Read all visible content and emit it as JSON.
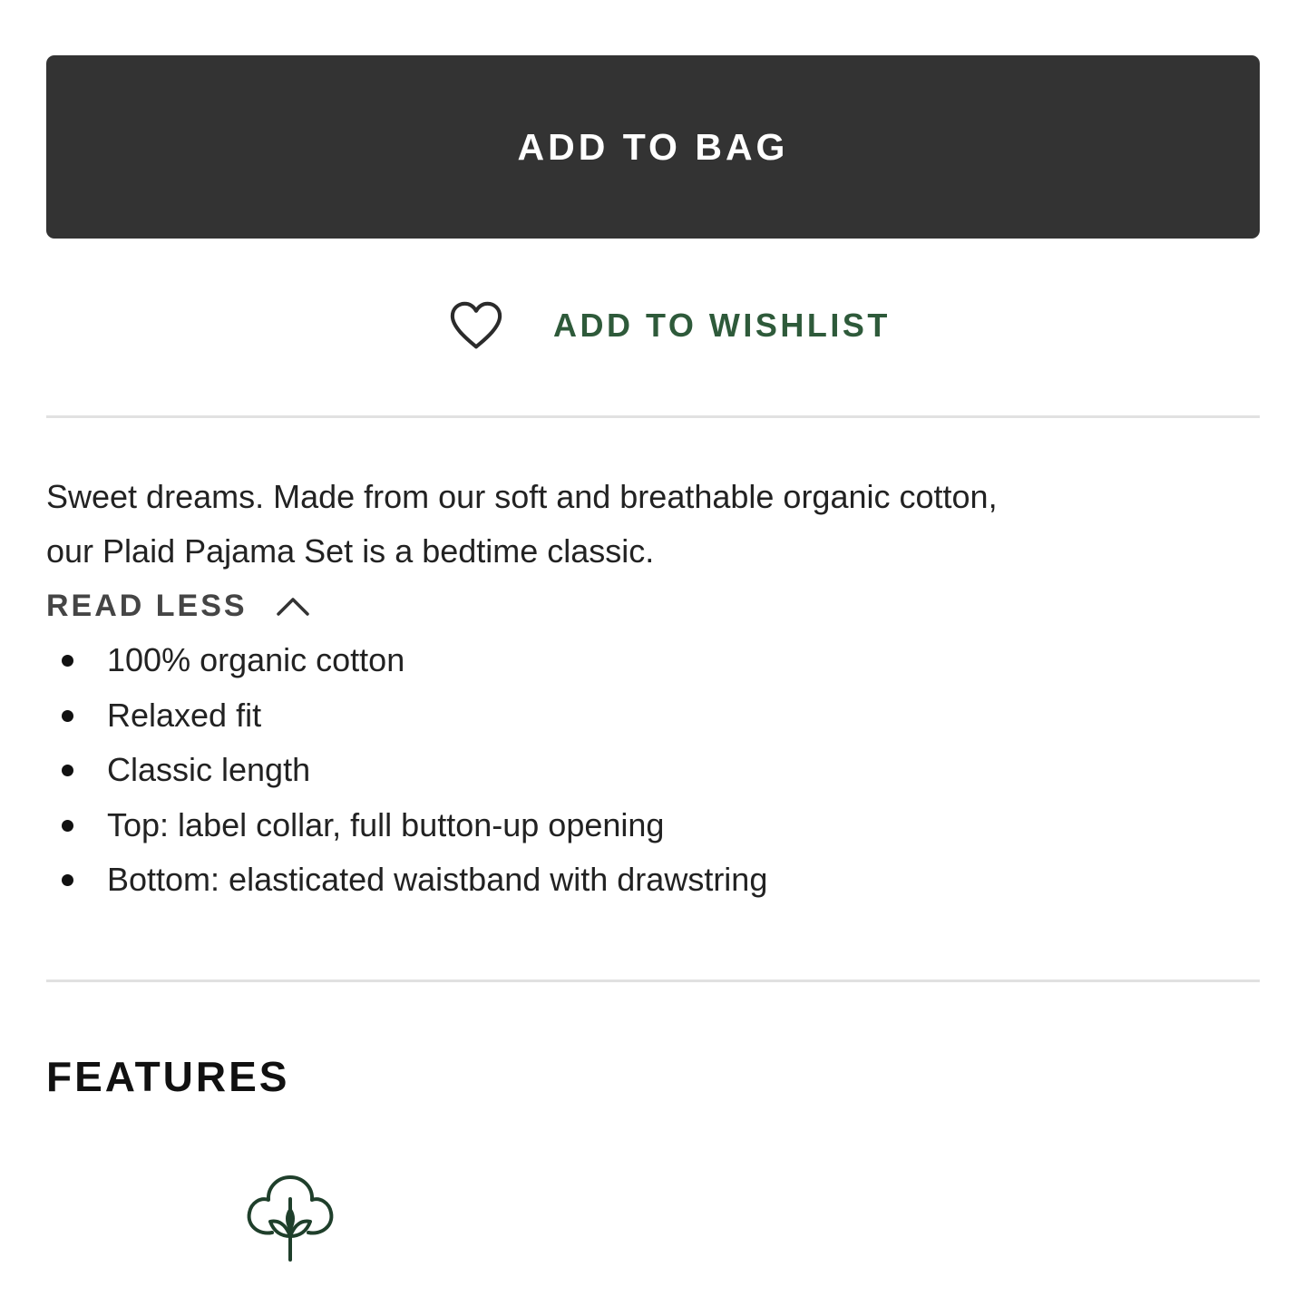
{
  "actions": {
    "add_to_bag_label": "ADD TO BAG",
    "wishlist_label": "ADD TO WISHLIST",
    "wishlist_icon": "heart-outline-icon"
  },
  "product": {
    "description": "Sweet dreams. Made from our soft and breathable organic cotton, our Plaid Pajama Set is a bedtime classic.",
    "read_less_label": "READ LESS",
    "read_less_icon": "chevron-up-icon",
    "details": [
      "100% organic cotton",
      "Relaxed fit",
      "Classic length",
      "Top: label collar, full button-up opening",
      "Bottom: elasticated waistband with drawstring"
    ]
  },
  "features": {
    "title": "FEATURES",
    "icons": [
      "cotton-plant-icon"
    ]
  },
  "colors": {
    "button_bg": "#333333",
    "button_text": "#ffffff",
    "wishlist_text": "#2e5a3a",
    "divider": "#e1e1e1",
    "feature_icon": "#1f3f2b"
  }
}
